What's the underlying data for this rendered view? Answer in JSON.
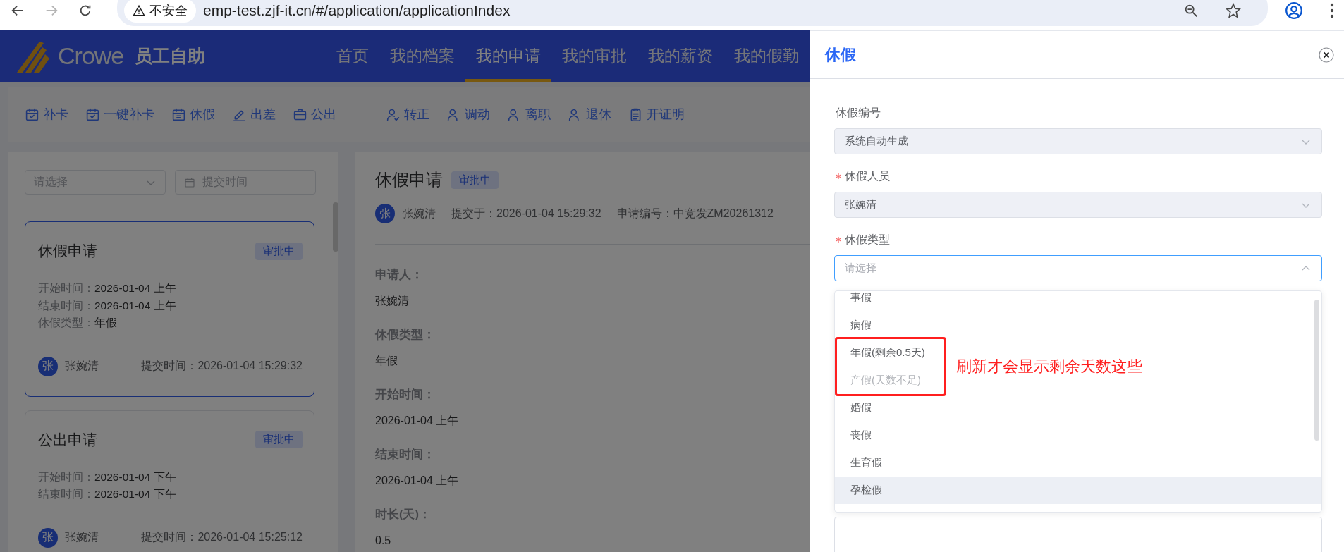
{
  "browser": {
    "forward_disabled": true,
    "security_label": "不安全",
    "url": "emp-test.zjf-it.cn/#/application/applicationIndex"
  },
  "header": {
    "logo_text": "Crowe",
    "app_name": "员工自助",
    "nav": [
      {
        "label": "首页",
        "selected": false
      },
      {
        "label": "我的档案",
        "selected": false
      },
      {
        "label": "我的申请",
        "selected": true
      },
      {
        "label": "我的审批",
        "selected": false
      },
      {
        "label": "我的薪资",
        "selected": false
      },
      {
        "label": "我的假勤",
        "selected": false
      }
    ]
  },
  "toolbar": {
    "groups": [
      [
        {
          "label": "补卡"
        },
        {
          "label": "一键补卡"
        },
        {
          "label": "休假"
        },
        {
          "label": "出差"
        },
        {
          "label": "公出"
        }
      ],
      [
        {
          "label": "转正"
        },
        {
          "label": "调动"
        },
        {
          "label": "离职"
        },
        {
          "label": "退休"
        },
        {
          "label": "开证明"
        }
      ]
    ]
  },
  "list": {
    "filter_placeholder": "请选择",
    "date_placeholder": "提交时间",
    "cards": [
      {
        "title": "休假申请",
        "status": "审批中",
        "selected": true,
        "fields": [
          {
            "label": "开始时间：",
            "value": "2026-01-04 上午"
          },
          {
            "label": "结束时间：",
            "value": "2026-01-04 上午"
          },
          {
            "label": "休假类型：",
            "value": "年假"
          }
        ],
        "avatar": "张",
        "name": "张婉清",
        "submitted_label": "提交时间：",
        "submitted": "2026-01-04 15:29:32"
      },
      {
        "title": "公出申请",
        "status": "审批中",
        "selected": false,
        "fields": [
          {
            "label": "开始时间：",
            "value": "2026-01-04 下午"
          },
          {
            "label": "结束时间：",
            "value": "2026-01-04 下午"
          }
        ],
        "avatar": "张",
        "name": "张婉清",
        "submitted_label": "提交时间：",
        "submitted": "2026-01-04 15:25:12"
      }
    ]
  },
  "detail": {
    "title": "休假申请",
    "status": "审批中",
    "avatar": "张",
    "name": "张婉清",
    "submitted": "提交于：2026-01-04 15:29:32",
    "number": "申请编号：中竞发ZM20261312",
    "fields": [
      {
        "label": "申请人：",
        "value": "张婉清"
      },
      {
        "label": "休假类型：",
        "value": "年假"
      },
      {
        "label": "开始时间：",
        "value": "2026-01-04 上午"
      },
      {
        "label": "结束时间：",
        "value": "2026-01-04 上午"
      },
      {
        "label": "时长(天)：",
        "value": "0.5"
      }
    ]
  },
  "drawer": {
    "title": "休假",
    "fields": [
      {
        "label": "休假编号",
        "required": false,
        "value": "系统自动生成",
        "disabled": true,
        "open": false
      },
      {
        "label": "休假人员",
        "required": true,
        "value": "张婉清",
        "disabled": true,
        "open": false
      },
      {
        "label": "休假类型",
        "required": true,
        "placeholder": "请选择",
        "disabled": false,
        "open": true
      }
    ],
    "dropdown": {
      "annotation": "刷新才会显示剩余天数这些",
      "options": [
        {
          "label": "事假",
          "disabled": false,
          "hovered": false,
          "annotated": false
        },
        {
          "label": "病假",
          "disabled": false,
          "hovered": false,
          "annotated": false
        },
        {
          "label": "年假(剩余0.5天)",
          "disabled": false,
          "hovered": false,
          "annotated": true
        },
        {
          "label": "产假(天数不足)",
          "disabled": true,
          "hovered": false,
          "annotated": true
        },
        {
          "label": "婚假",
          "disabled": false,
          "hovered": false,
          "annotated": false
        },
        {
          "label": "丧假",
          "disabled": false,
          "hovered": false,
          "annotated": false
        },
        {
          "label": "生育假",
          "disabled": false,
          "hovered": false,
          "annotated": false
        },
        {
          "label": "孕检假",
          "disabled": false,
          "hovered": true,
          "annotated": false
        }
      ]
    }
  }
}
